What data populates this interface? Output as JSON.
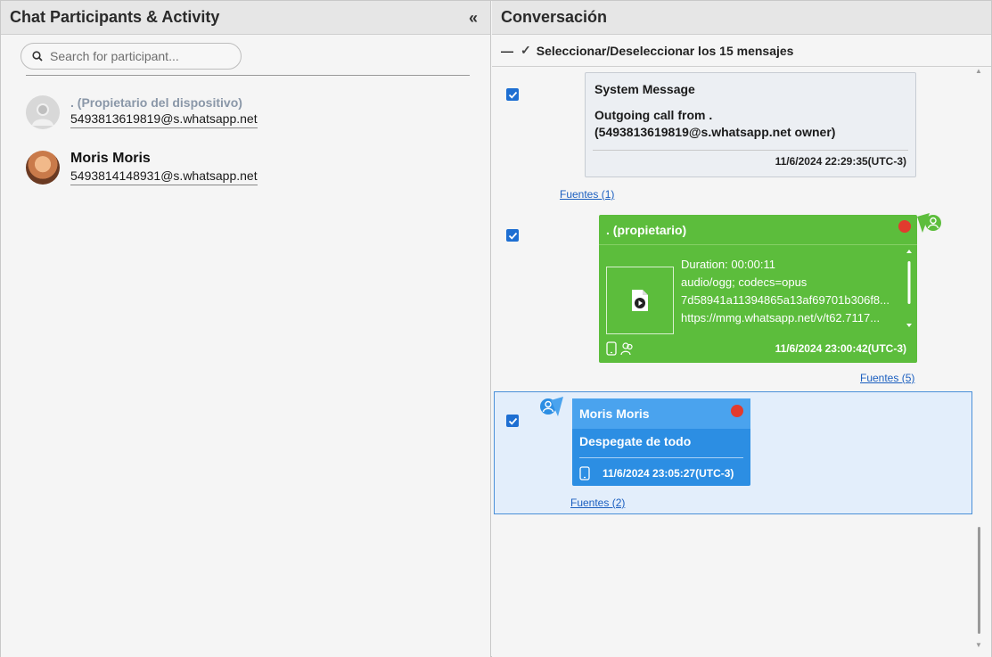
{
  "left": {
    "header_title": "Chat Participants & Activity",
    "collapse_icon": "double-chevron-left-icon",
    "search_placeholder": "Search for participant...",
    "participants": [
      {
        "name": ". (Propietario del dispositivo)",
        "phone": "5493813619819@s.whatsapp.net",
        "avatar": "default-avatar-icon"
      },
      {
        "name": "Moris Moris",
        "phone": "5493814148931@s.whatsapp.net",
        "avatar": "profile-photo"
      }
    ]
  },
  "right": {
    "header_title": "Conversación",
    "select_all_label": "Seleccionar/Deseleccionar los 15 mensajes",
    "messages": [
      {
        "type": "system",
        "title": "System Message",
        "body": "Outgoing call from . (5493813619819@s.whatsapp.net owner)",
        "time": "11/6/2024 22:29:35(UTC-3)",
        "sources": "Fuentes (1)",
        "checked": true
      },
      {
        "type": "outgoing",
        "sender": ". (propietario)",
        "media_lines": [
          "Duration: 00:00:11",
          "audio/ogg; codecs=opus",
          "7d58941a11394865a13af69701b306f8...",
          "https://mmg.whatsapp.net/v/t62.7117..."
        ],
        "time": "11/6/2024 23:00:42(UTC-3)",
        "sources": "Fuentes (5)",
        "checked": true
      },
      {
        "type": "incoming",
        "sender": "Moris Moris",
        "body": "Despegate de todo",
        "time": "11/6/2024 23:05:27(UTC-3)",
        "sources": "Fuentes (2)",
        "checked": true
      }
    ]
  },
  "colors": {
    "outgoing": "#5cbd3c",
    "incoming": "#2c8ee3",
    "system": "#eceff3",
    "checkbox": "#1e6fd2",
    "deleted_dot": "#e23b2e"
  }
}
